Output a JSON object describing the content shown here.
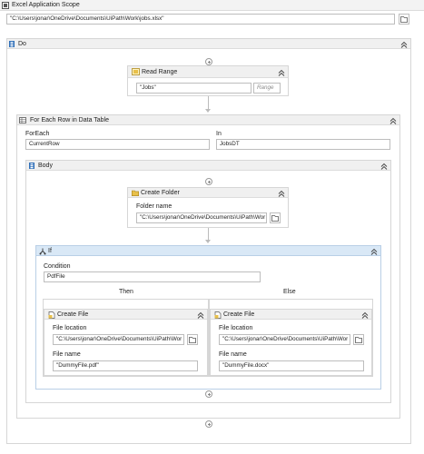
{
  "scope": {
    "title": "Excel Application Scope",
    "workbook_path": "\"C:\\Users\\jonar\\OneDrive\\Documents\\UiPath\\Work\\jobs.xlsx\""
  },
  "do_sequence": {
    "title": "Do"
  },
  "read_range": {
    "title": "Read Range",
    "sheet": "\"Jobs\"",
    "range_placeholder": "Range"
  },
  "for_each": {
    "title": "For Each Row in Data Table",
    "foreach_label": "ForEach",
    "foreach_value": "CurrentRow",
    "in_label": "In",
    "in_value": "JobsDT"
  },
  "body": {
    "title": "Body"
  },
  "create_folder": {
    "title": "Create Folder",
    "folder_label": "Folder name",
    "folder_value": "\"C:\\Users\\jonar\\OneDrive\\Documents\\UiPath\\Wor"
  },
  "if_activity": {
    "title": "If",
    "condition_label": "Condition",
    "condition_value": "PdfFile",
    "then_label": "Then",
    "else_label": "Else"
  },
  "then_create_file": {
    "title": "Create File",
    "location_label": "File location",
    "location_value": "\"C:\\Users\\jonar\\OneDrive\\Documents\\UiPath\\Wor",
    "name_label": "File name",
    "name_value": "\"DummyFile.pdf\""
  },
  "else_create_file": {
    "title": "Create File",
    "location_label": "File location",
    "location_value": "\"C:\\Users\\jonar\\OneDrive\\Documents\\UiPath\\Wor",
    "name_label": "File name",
    "name_value": "\"DummyFile.docx\""
  },
  "icons": {
    "scope": "excel-scope-icon",
    "sequence": "sequence-icon",
    "read_range": "excel-read-range-icon",
    "for_each": "table-icon",
    "folder": "folder-icon",
    "if": "if-branch-icon",
    "file": "file-icon",
    "collapse": "chevron-up-icon",
    "add": "add-activity-icon"
  },
  "colors": {
    "if_header": "#d9e8f6",
    "folder_icon": "#e8c04a",
    "sequence_icon": "#2f6fb8"
  }
}
